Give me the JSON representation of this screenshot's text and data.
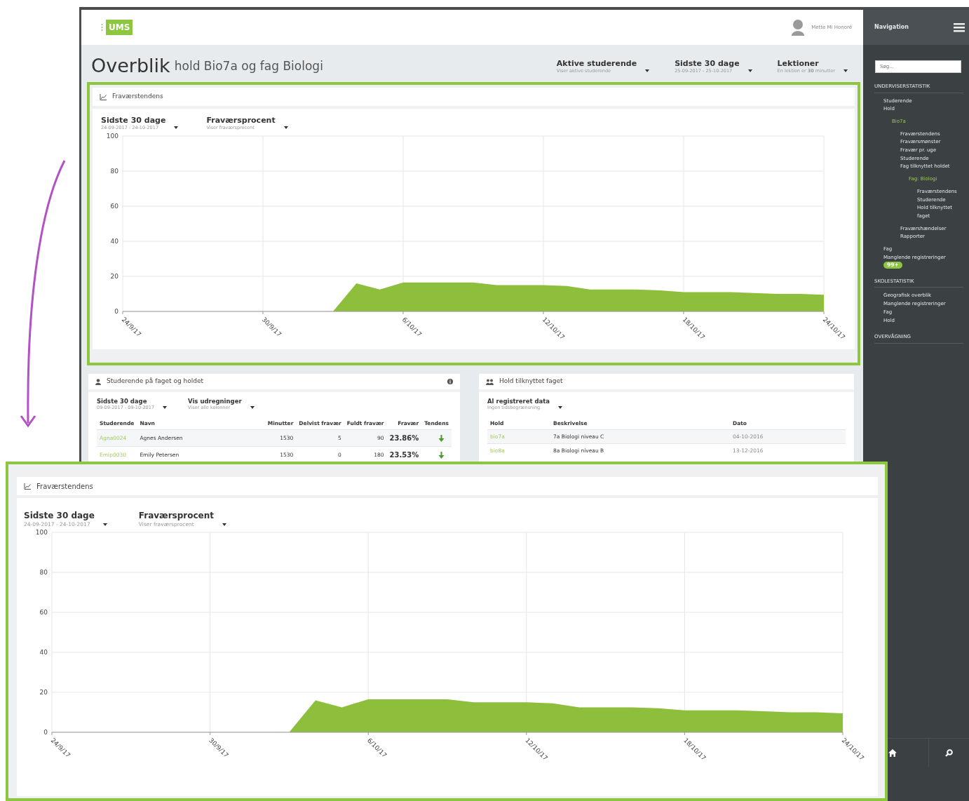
{
  "header": {
    "logo": "UMS",
    "user": "Mette Mi Honoré"
  },
  "title": {
    "main": "Overblik",
    "sub": "hold Bio7a og fag Biologi"
  },
  "filters": [
    {
      "label": "Aktive studerende",
      "sub": "Viser aktive studerende"
    },
    {
      "label": "Sidste 30 dage",
      "sub": "25-09-2017 - 25-10-2017"
    },
    {
      "label": "Lektioner",
      "sub": "En lektion er **30** minutter"
    }
  ],
  "trend_panel": {
    "title": "Fraværstendens",
    "filters": [
      {
        "label": "Sidste 30 dage",
        "sub": "24-09-2017 - 24-10-2017"
      },
      {
        "label": "Fraværsprocent",
        "sub": "Viser fraværsprocent"
      }
    ],
    "chart_data": {
      "type": "area",
      "categories": [
        "24/9/17",
        null,
        null,
        null,
        null,
        null,
        "30/9/17",
        null,
        null,
        null,
        null,
        null,
        "6/10/17",
        null,
        null,
        null,
        null,
        null,
        "12/10/17",
        null,
        null,
        null,
        null,
        null,
        "18/10/17",
        null,
        null,
        null,
        null,
        null,
        "24/10/17"
      ],
      "series": [
        {
          "color": "#8dbf3c",
          "values": [
            null,
            null,
            null,
            null,
            null,
            null,
            null,
            null,
            null,
            0,
            16,
            12.5,
            16.5,
            16.5,
            16.5,
            16.5,
            15,
            15,
            15,
            14.5,
            12.5,
            12.5,
            12.5,
            12,
            11,
            11,
            11,
            10.5,
            10,
            10,
            9.5
          ]
        }
      ],
      "ylim": [
        0,
        100
      ],
      "yticks": [
        0,
        20,
        40,
        60,
        80,
        100
      ],
      "grid": true
    }
  },
  "students_panel": {
    "title": "Studerende på faget og holdet",
    "filters": [
      {
        "label": "Sidste 30 dage",
        "sub": "09-09-2017 - 09-10-2017"
      },
      {
        "label": "Vis udregninger",
        "sub": "Viser alle kolonner"
      }
    ],
    "columns": [
      "Studerende",
      "Navn",
      "Minutter",
      "Delvist fravær",
      "Fuldt fravær",
      "Fravær",
      "Tendens"
    ],
    "rows": [
      {
        "student": "Agna0024",
        "name": "Agnes Andersen",
        "minutes": "1530",
        "partial": "5",
        "full": "90",
        "absence": "23.86%",
        "kind": "down"
      },
      {
        "student": "Emip0030",
        "name": "Emily Petersen",
        "minutes": "1530",
        "partial": "0",
        "full": "180",
        "absence": "23.53%",
        "kind": "down"
      }
    ]
  },
  "teams_panel": {
    "title": "Hold tilknyttet faget",
    "filters": [
      {
        "label": "Al registreret data",
        "sub": "Ingen tidsbegrænsning"
      }
    ],
    "columns": [
      "Hold",
      "Beskrivelse",
      "Dato"
    ],
    "rows": [
      {
        "team": "bio7a",
        "description": "7a Biologi niveau C",
        "date": "04-10-2016"
      },
      {
        "team": "bio8a",
        "description": "8a Biologi niveau B",
        "date": "13-12-2016"
      }
    ]
  },
  "navigation": {
    "title": "Navigation",
    "search": {
      "placeholder": "Søg..."
    },
    "sections": [
      {
        "title": "UNDERVISERSTATISTIK",
        "items": [
          {
            "label": "Studerende",
            "selected": false
          },
          {
            "label": "Hold",
            "selected": false,
            "children": [
              {
                "label": "Bio7a",
                "selected": true,
                "children": [
                  {
                    "label": "Fraværstendens",
                    "selected": false
                  },
                  {
                    "label": "Fraværsmønster",
                    "selected": false
                  },
                  {
                    "label": "Fravær pr. uge",
                    "selected": false
                  },
                  {
                    "label": "Studerende",
                    "selected": false
                  },
                  {
                    "label": "Fag tilknyttet holdet",
                    "selected": false,
                    "children": [
                      {
                        "label": "Fag: Biologi",
                        "selected": true,
                        "children": [
                          {
                            "label": "Fraværstendens",
                            "selected": false
                          },
                          {
                            "label": "Studerende",
                            "selected": false
                          },
                          {
                            "label": "Hold tilknyttet faget",
                            "selected": false
                          }
                        ]
                      }
                    ]
                  },
                  {
                    "label": "Fraværshændelser",
                    "selected": false
                  },
                  {
                    "label": "Rapporter",
                    "selected": false
                  }
                ]
              }
            ]
          },
          {
            "label": "Fag",
            "selected": false
          },
          {
            "label": "Manglende registreringer",
            "selected": false,
            "badge": "99+"
          }
        ]
      },
      {
        "title": "SKOLESTATISTIK",
        "items": [
          {
            "label": "Geografisk overblik",
            "selected": false
          },
          {
            "label": "Manglende registreringer",
            "selected": false
          },
          {
            "label": "Fag",
            "selected": false
          },
          {
            "label": "Hold",
            "selected": false
          }
        ]
      },
      {
        "title": "OVERVÅGNING"
      }
    ]
  },
  "zoomed_trend_panel": {
    "title": "Fraværstendens",
    "filters": [
      {
        "label": "Sidste 30 dage",
        "sub": "24-09-2017 - 24-10-2017"
      },
      {
        "label": "Fraværsprocent",
        "sub": "Viser fraværsprocent"
      }
    ],
    "chart_data": {
      "type": "area",
      "categories": [
        "24/9/17",
        null,
        null,
        null,
        null,
        null,
        "30/9/17",
        null,
        null,
        null,
        null,
        null,
        "6/10/17",
        null,
        null,
        null,
        null,
        null,
        "12/10/17",
        null,
        null,
        null,
        null,
        null,
        "18/10/17",
        null,
        null,
        null,
        null,
        null,
        "24/10/17"
      ],
      "series": [
        {
          "color": "#8dbf3c",
          "values": [
            null,
            null,
            null,
            null,
            null,
            null,
            null,
            null,
            null,
            0,
            16,
            12.5,
            16.5,
            16.5,
            16.5,
            16.5,
            15,
            15,
            15,
            14.5,
            12.5,
            12.5,
            12.5,
            12,
            11,
            11,
            11,
            10.5,
            10,
            10,
            9.5
          ]
        }
      ],
      "ylim": [
        0,
        100
      ],
      "yticks": [
        0,
        20,
        40,
        60,
        80,
        100
      ],
      "grid": true
    }
  }
}
